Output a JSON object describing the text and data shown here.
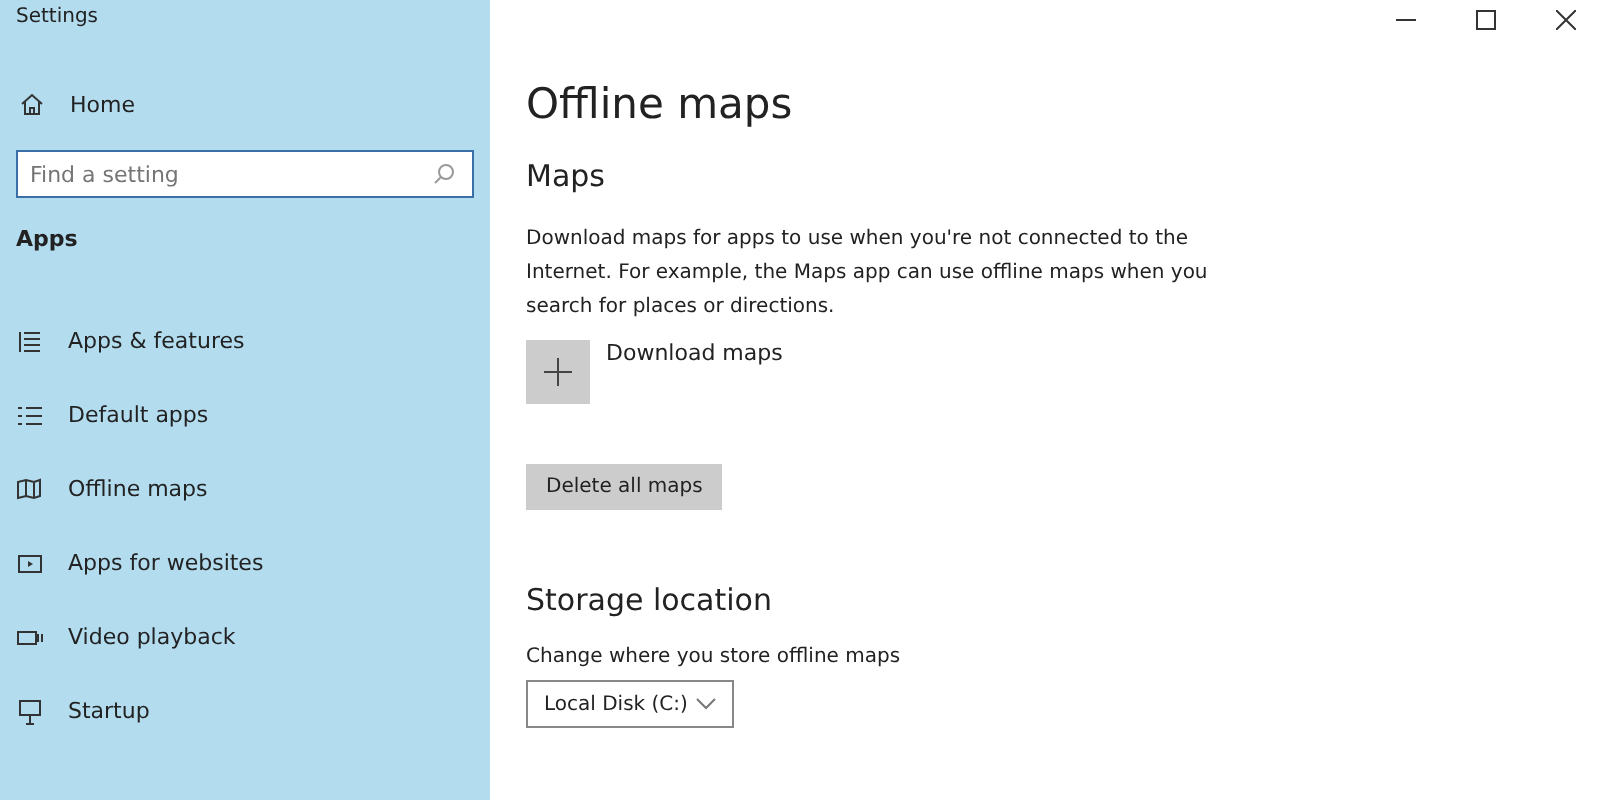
{
  "window": {
    "title": "Settings"
  },
  "sidebar": {
    "home": "Home",
    "search": {
      "placeholder": "Find a setting"
    },
    "section": "Apps",
    "items": [
      {
        "label": "Apps & features"
      },
      {
        "label": "Default apps"
      },
      {
        "label": "Offline maps"
      },
      {
        "label": "Apps for websites"
      },
      {
        "label": "Video playback"
      },
      {
        "label": "Startup"
      }
    ]
  },
  "main": {
    "title": "Offline maps",
    "maps": {
      "heading": "Maps",
      "description": "Download maps for apps to use when you're not connected to the Internet. For example, the Maps app can use offline maps when you search for places or directions.",
      "download": "Download maps",
      "delete": "Delete all maps"
    },
    "storage": {
      "heading": "Storage location",
      "label": "Change where you store offline maps",
      "value": "Local Disk (C:)"
    }
  }
}
